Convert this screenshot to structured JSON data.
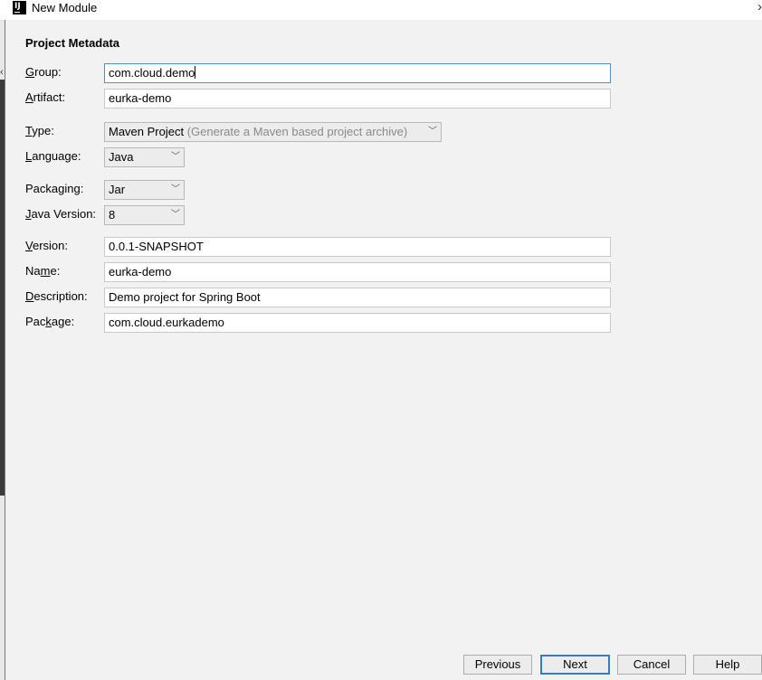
{
  "window": {
    "title": "New Module",
    "close_glyph": "›",
    "app_icon_text": "IJ"
  },
  "form": {
    "section_title": "Project Metadata",
    "group": {
      "label_u": "G",
      "label_rest": "roup:",
      "value": "com.cloud.demo"
    },
    "artifact": {
      "label_u": "A",
      "label_rest": "rtifact:",
      "value": "eurka-demo"
    },
    "type": {
      "label_u": "T",
      "label_rest": "ype:",
      "value": "Maven Project",
      "hint": "(Generate a Maven based project archive)"
    },
    "language": {
      "label_u": "L",
      "label_rest": "anguage:",
      "value": "Java"
    },
    "packaging": {
      "label_pre": "Packa",
      "label_u": "g",
      "label_rest": "ing:",
      "value": "Jar"
    },
    "java_version": {
      "label_u": "J",
      "label_rest": "ava Version:",
      "value": "8"
    },
    "version": {
      "label_u": "V",
      "label_rest": "ersion:",
      "value": "0.0.1-SNAPSHOT"
    },
    "name": {
      "label_pre": "Na",
      "label_u": "m",
      "label_rest": "e:",
      "value": "eurka-demo"
    },
    "description": {
      "label_u": "D",
      "label_rest": "escription:",
      "value": "Demo project for Spring Boot"
    },
    "package": {
      "label_pre": "Pac",
      "label_u": "k",
      "label_rest": "age:",
      "value": "com.cloud.eurkademo"
    }
  },
  "buttons": {
    "previous": "Previous",
    "next": "Next",
    "cancel": "Cancel",
    "help": "Help"
  },
  "icons": {
    "app": "intellij-icon",
    "dropdown": "chevron-down-icon",
    "close": "close-icon"
  }
}
